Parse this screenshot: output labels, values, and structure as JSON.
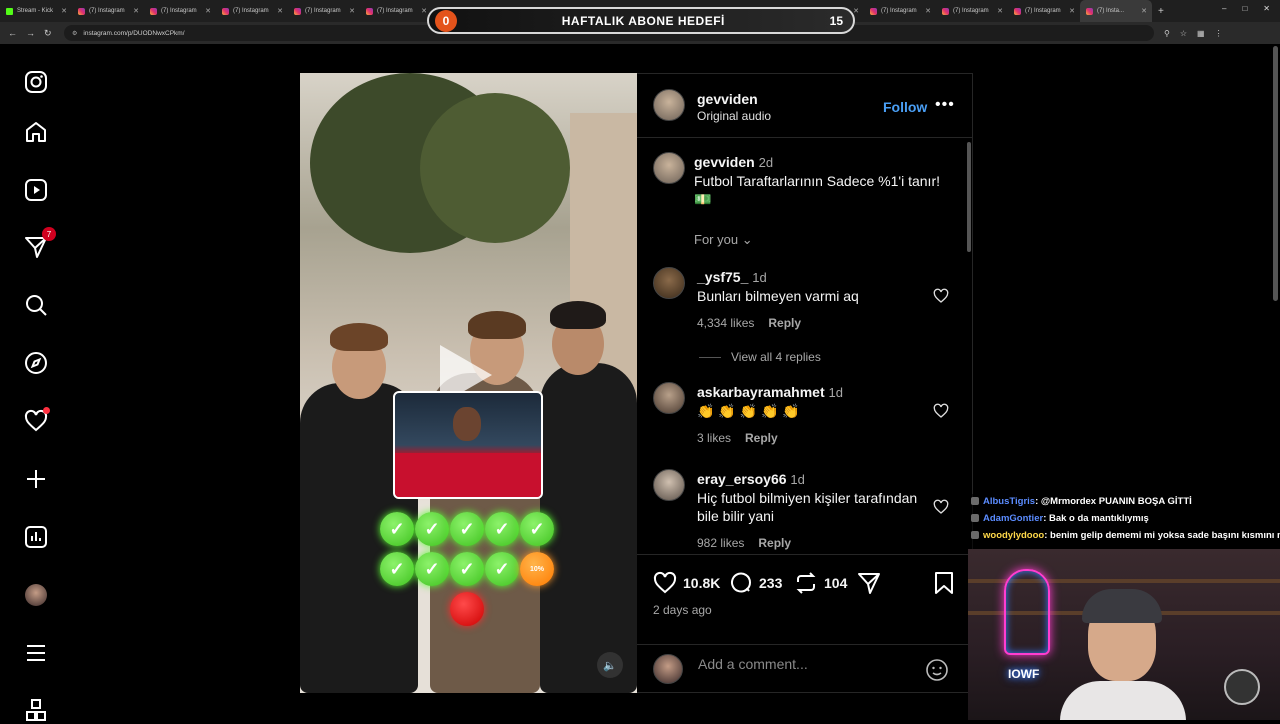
{
  "browser": {
    "tabs": [
      {
        "label": "Stream - Kick",
        "kind": "kick"
      },
      {
        "label": "(7) Instagram",
        "kind": "ig"
      },
      {
        "label": "(7) Instagram",
        "kind": "ig"
      },
      {
        "label": "(7) Instagram",
        "kind": "ig"
      },
      {
        "label": "(7) Instagram",
        "kind": "ig"
      },
      {
        "label": "(7) Instagram",
        "kind": "ig"
      },
      {
        "label": "(7) Instagram",
        "kind": "ig"
      },
      {
        "label": "(7) Instagram",
        "kind": "ig"
      },
      {
        "label": "(7) Instagram",
        "kind": "ig"
      },
      {
        "label": "(7) Instagram",
        "kind": "ig"
      },
      {
        "label": "(7) Instagram",
        "kind": "ig"
      },
      {
        "label": "(7) Instagram",
        "kind": "ig"
      },
      {
        "label": "(7) Instagram",
        "kind": "ig"
      },
      {
        "label": "(7) Instagram",
        "kind": "ig"
      },
      {
        "label": "(7) Instagram",
        "kind": "ig"
      },
      {
        "label": "(7) Insta...",
        "kind": "ig",
        "active": true
      }
    ],
    "url": "instagram.com/p/DUODNwxCPkm/"
  },
  "overlay_goal": {
    "left_value": "0",
    "title": "HAFTALIK ABONE HEDEFİ",
    "right_value": "15"
  },
  "sidebar": {
    "notifications_badge": "7",
    "items": [
      "instagram-logo",
      "home-icon",
      "reels-icon",
      "messages-icon",
      "search-icon",
      "explore-icon",
      "notifications-icon",
      "create-icon",
      "dashboard-icon",
      "profile-avatar",
      "menu-icon",
      "more-apps-icon"
    ]
  },
  "post": {
    "author": "gevviden",
    "audio": "Original audio",
    "follow_label": "Follow",
    "caption_author": "gevviden",
    "caption_age": "2d",
    "caption_text": "Futbol Taraftarlarının Sadece %1'i tanır!",
    "caption_emoji": "💵",
    "filter_label": "For you",
    "comments": [
      {
        "user": "_ysf75_",
        "age": "1d",
        "text": "Bunları bilmeyen varmi aq",
        "likes": "4,334 likes",
        "reply": "Reply"
      },
      {
        "user": "askarbayramahmet",
        "age": "1d",
        "text": "👏 👏 👏 👏 👏",
        "likes": "3 likes",
        "reply": "Reply"
      },
      {
        "user": "eray_ersoy66",
        "age": "1d",
        "text": "Hiç futbol bilmiyen kişiler tarafından bile bilir yani",
        "likes": "982 likes",
        "reply": "Reply"
      }
    ],
    "view_replies": "View all 4 replies",
    "like_count": "10.8K",
    "comment_count": "233",
    "repost_count": "104",
    "posted_ago": "2 days ago",
    "add_comment_placeholder": "Add a comment..."
  },
  "video_overlay": {
    "quiz_progress_label": "10%"
  },
  "chat": [
    {
      "user": "AlbusTigris",
      "user_color": "#5b8cff",
      "message": ": @Mrmordex PUANIN BOŞA GİTTİ"
    },
    {
      "user": "AdamGontier",
      "user_color": "#5b8cff",
      "message": ": Bak o da mantıklıymış"
    },
    {
      "user": "woodylydooo",
      "user_color": "#ffd94a",
      "message": ": benim gelip dememi mi yoksa sade başını kısmını mı"
    }
  ],
  "webcam": {
    "neon_text": "IOWF"
  },
  "colors": {
    "accent_blue": "#4a9ff5",
    "badge_red": "#d1001f",
    "panel_bg": "#000000"
  }
}
